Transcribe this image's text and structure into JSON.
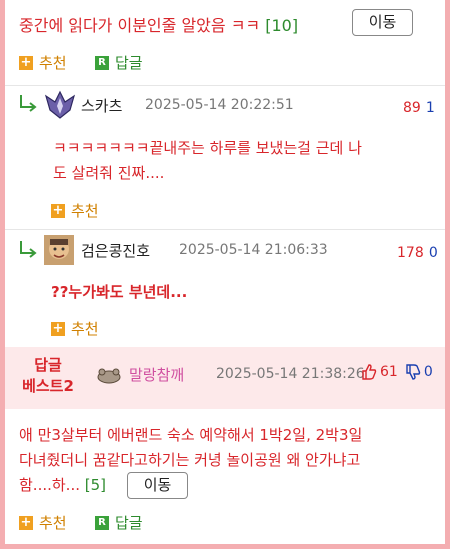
{
  "top": {
    "title": "중간에 읽다가 이분인줄 알았음 ㅋㅋ",
    "count": "[10]",
    "move_label": "이동",
    "recommend_label": "추천",
    "reply_label": "답글"
  },
  "comments": [
    {
      "nick": "스카츠",
      "date": "2025-05-14 20:22:51",
      "up": "89",
      "down": "1",
      "body_line1": "ㅋㅋㅋㅋㅋㅋㅋ끝내주는 하루를 보냈는걸 근데 나",
      "body_line2": "도 살려줘 진짜....",
      "recommend_label": "추천"
    },
    {
      "nick": "검은콩진호",
      "date": "2025-05-14 21:06:33",
      "up": "178",
      "down": "0",
      "body_line1": "??누가봐도 부년데...",
      "recommend_label": "추천"
    }
  ],
  "best": {
    "tag_line1": "답글",
    "tag_line2": "베스트2",
    "nick": "말랑참깨",
    "date": "2025-05-14 21:38:26",
    "up": "61",
    "down": "0",
    "body_line1": "애 만3살부터 에버랜드 숙소 예약해서 1박2일, 2박3일",
    "body_line2": "다녀줬더니 꿈같다고하기는 커녕 놀이공원 왜 안가냐고",
    "body_line3": "함....하...",
    "count": "[5]",
    "move_label": "이동",
    "recommend_label": "추천",
    "reply_label": "답글"
  },
  "icons": {
    "plus": "plus-icon",
    "reply_badge": "reply-badge-icon",
    "reply_arrow": "reply-arrow-icon",
    "thumbs_up": "thumbs-up-icon",
    "thumbs_down": "thumbs-down-icon"
  },
  "colors": {
    "accent_red": "#d8262b",
    "green": "#2e8b2e",
    "orange": "#d08000",
    "frame_pink": "#f4aeb1",
    "best_bg": "#fde9ea"
  }
}
